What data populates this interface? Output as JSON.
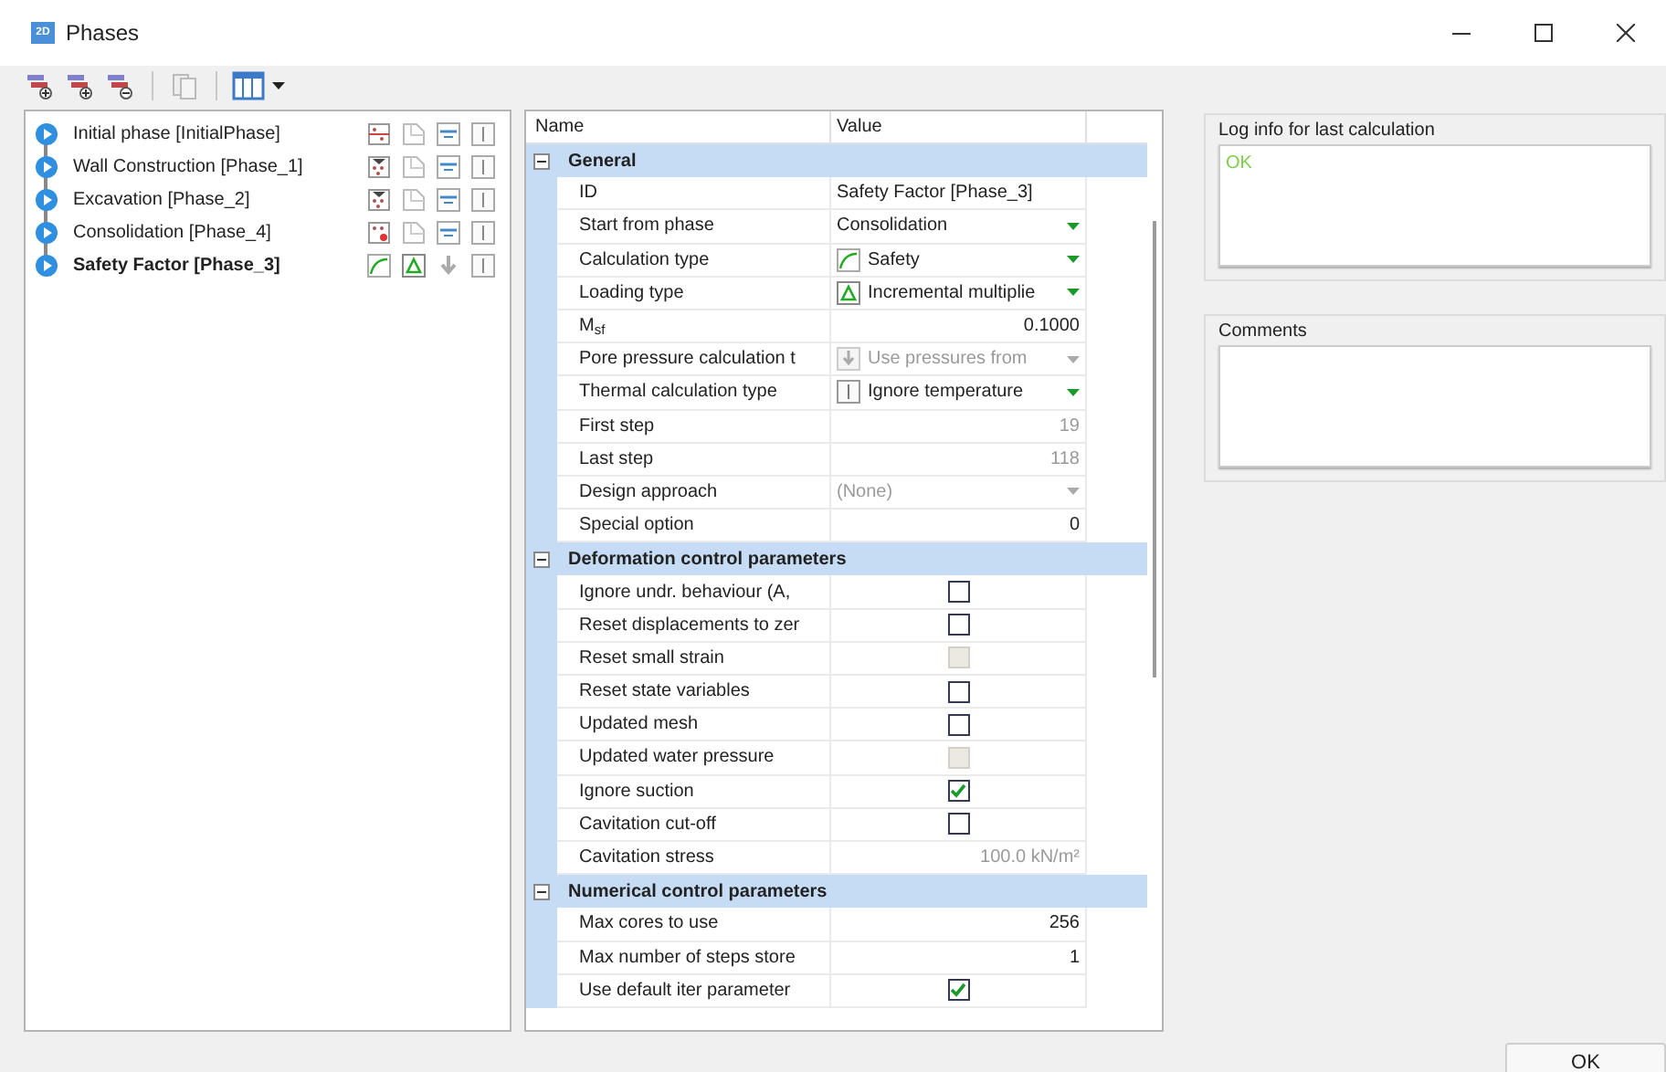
{
  "window": {
    "title": "Phases",
    "app_icon_text": "2D"
  },
  "phases": [
    {
      "label": "Initial phase [InitialPhase]",
      "selected": false
    },
    {
      "label": "Wall Construction [Phase_1]",
      "selected": false
    },
    {
      "label": "Excavation [Phase_2]",
      "selected": false
    },
    {
      "label": "Consolidation [Phase_4]",
      "selected": false
    },
    {
      "label": "Safety Factor [Phase_3]",
      "selected": true
    }
  ],
  "properties": {
    "columns": [
      "Name",
      "Value"
    ],
    "groups": [
      {
        "title": "General",
        "expanded": true,
        "rows": [
          {
            "name": "ID",
            "kind": "text",
            "value": "Safety Factor [Phase_3]",
            "disabled": false
          },
          {
            "name": "Start from phase",
            "kind": "dropdown",
            "value": "Consolidation",
            "disabled": false
          },
          {
            "name": "Calculation type",
            "kind": "dropdown",
            "value": "Safety",
            "disabled": false
          },
          {
            "name": "Loading type",
            "kind": "dropdown",
            "value": "Incremental multiplie",
            "disabled": false
          },
          {
            "name": "M$_{sf}$",
            "kind": "number",
            "value": "0.1000",
            "disabled": false
          },
          {
            "name": "Pore pressure calculation t",
            "kind": "dropdown",
            "value": "Use pressures from",
            "disabled": true
          },
          {
            "name": "Thermal calculation type",
            "kind": "dropdown",
            "value": "Ignore temperature",
            "disabled": false
          },
          {
            "name": "First step",
            "kind": "number",
            "value": "19",
            "disabled": true
          },
          {
            "name": "Last step",
            "kind": "number",
            "value": "118",
            "disabled": true
          },
          {
            "name": "Design approach",
            "kind": "dropdown",
            "value": "(None)",
            "disabled": true
          },
          {
            "name": "Special option",
            "kind": "number",
            "value": "0",
            "disabled": false
          }
        ]
      },
      {
        "title": "Deformation control parameters",
        "expanded": true,
        "rows": [
          {
            "name": "Ignore undr. behaviour (A,",
            "kind": "checkbox",
            "checked": false,
            "disabled": false
          },
          {
            "name": "Reset displacements to zer",
            "kind": "checkbox",
            "checked": false,
            "disabled": false
          },
          {
            "name": "Reset small strain",
            "kind": "checkbox",
            "checked": false,
            "disabled": true
          },
          {
            "name": "Reset state variables",
            "kind": "checkbox",
            "checked": false,
            "disabled": false
          },
          {
            "name": "Updated mesh",
            "kind": "checkbox",
            "checked": false,
            "disabled": false
          },
          {
            "name": "Updated water pressure",
            "kind": "checkbox",
            "checked": false,
            "disabled": true
          },
          {
            "name": "Ignore suction",
            "kind": "checkbox",
            "checked": true,
            "disabled": false
          },
          {
            "name": "Cavitation cut-off",
            "kind": "checkbox",
            "checked": false,
            "disabled": false
          },
          {
            "name": "Cavitation stress",
            "kind": "number",
            "value": "100.0 kN/m²",
            "disabled": true
          }
        ]
      },
      {
        "title": "Numerical control parameters",
        "expanded": true,
        "rows": [
          {
            "name": "Max cores to use",
            "kind": "number",
            "value": "256",
            "disabled": false
          },
          {
            "name": "Max number of steps store",
            "kind": "number",
            "value": "1",
            "disabled": false
          },
          {
            "name": "Use default iter parameter",
            "kind": "checkbox",
            "checked": true,
            "disabled": false
          }
        ]
      }
    ]
  },
  "log": {
    "title": "Log info for last calculation",
    "text": "OK"
  },
  "comments": {
    "title": "Comments"
  },
  "buttons": [
    "OK"
  ]
}
